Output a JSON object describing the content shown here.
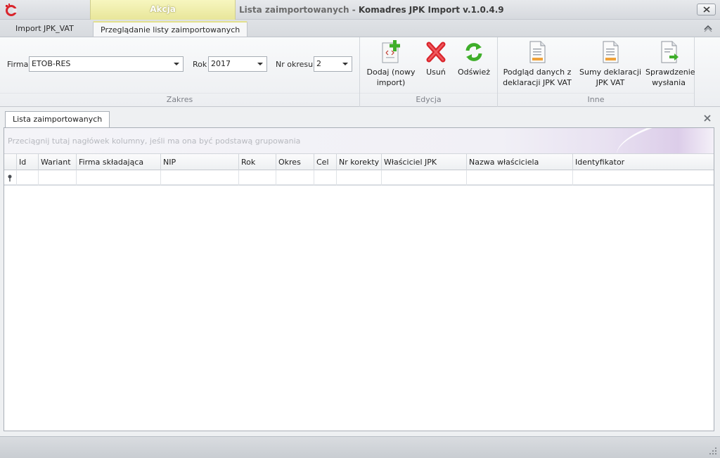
{
  "titlebar": {
    "context_tab": "Akcja",
    "title_sub": "Lista zaimportowanych - ",
    "title_main": "Komadres JPK Import v.1.0.4.9"
  },
  "ribbon_tabs": [
    "Import JPK_VAT",
    "Przeglądanie listy zaimportowanych"
  ],
  "ribbon": {
    "zakres": {
      "caption": "Zakres",
      "firma_label": "Firma",
      "firma_value": "ETOB-RES",
      "rok_label": "Rok",
      "rok_value": "2017",
      "okres_label": "Nr okresu",
      "okres_value": "2"
    },
    "edycja": {
      "caption": "Edycja",
      "dodaj_line1": "Dodaj (nowy",
      "dodaj_line2": "import)",
      "usun": "Usuń",
      "odswiez": "Odśwież"
    },
    "inne": {
      "caption": "Inne",
      "podglad_line1": "Podgląd danych z",
      "podglad_line2": "deklaracji JPK VAT",
      "sumy_line1": "Sumy deklaracji",
      "sumy_line2": "JPK VAT",
      "spr_line1": "Sprawdzenie",
      "spr_line2": "wysłania"
    }
  },
  "document": {
    "tab_label": "Lista zaimportowanych",
    "group_hint": "Przeciągnij tutaj nagłówek kolumny, jeśli ma ona być podstawą grupowania",
    "columns": [
      "Id",
      "Wariant",
      "Firma składająca",
      "NIP",
      "Rok",
      "Okres",
      "Cel",
      "Nr korekty",
      "Właściciel JPK",
      "Nazwa właściciela",
      "Identyfikator"
    ],
    "rows": []
  },
  "colors": {
    "context_tab": "#e8e69a",
    "accent_green": "#3fae2a",
    "delete_red": "#d9252c"
  }
}
